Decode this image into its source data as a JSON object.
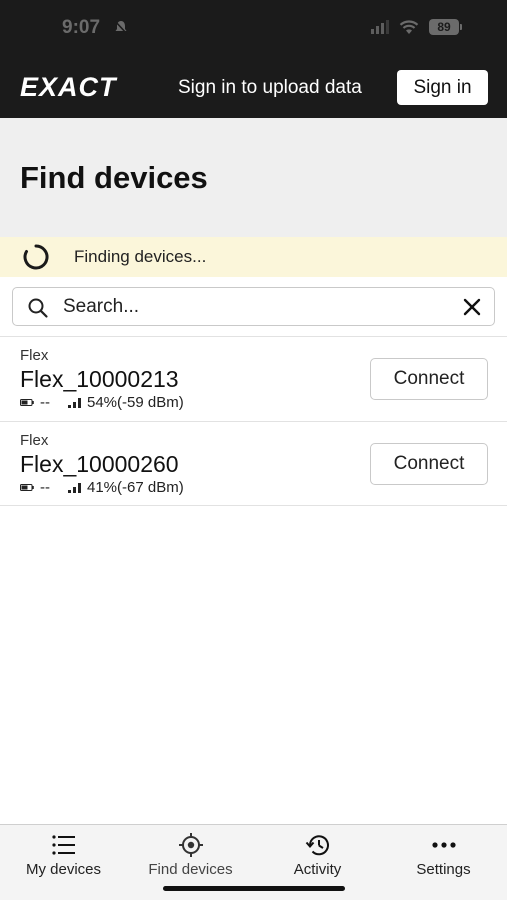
{
  "status_bar": {
    "time": "9:07",
    "battery": "89"
  },
  "header": {
    "brand": "EXACT",
    "signin_prompt": "Sign in to upload data",
    "signin_button": "Sign in"
  },
  "page": {
    "title": "Find devices"
  },
  "scan": {
    "status_text": "Finding devices..."
  },
  "search": {
    "placeholder": "Search...",
    "value": ""
  },
  "devices": [
    {
      "type": "Flex",
      "name": "Flex_10000213",
      "battery": "--",
      "signal": "54%(-59 dBm)",
      "action": "Connect"
    },
    {
      "type": "Flex",
      "name": "Flex_10000260",
      "battery": "--",
      "signal": "41%(-67 dBm)",
      "action": "Connect"
    }
  ],
  "tabs": [
    {
      "label": "My devices",
      "icon": "list-icon"
    },
    {
      "label": "Find devices",
      "icon": "locate-icon",
      "active": true
    },
    {
      "label": "Activity",
      "icon": "history-icon"
    },
    {
      "label": "Settings",
      "icon": "more-dots-icon"
    }
  ],
  "colors": {
    "header_bg": "#1b1b1b",
    "banner_bg": "#fbf6da",
    "title_bg": "#efefef"
  }
}
